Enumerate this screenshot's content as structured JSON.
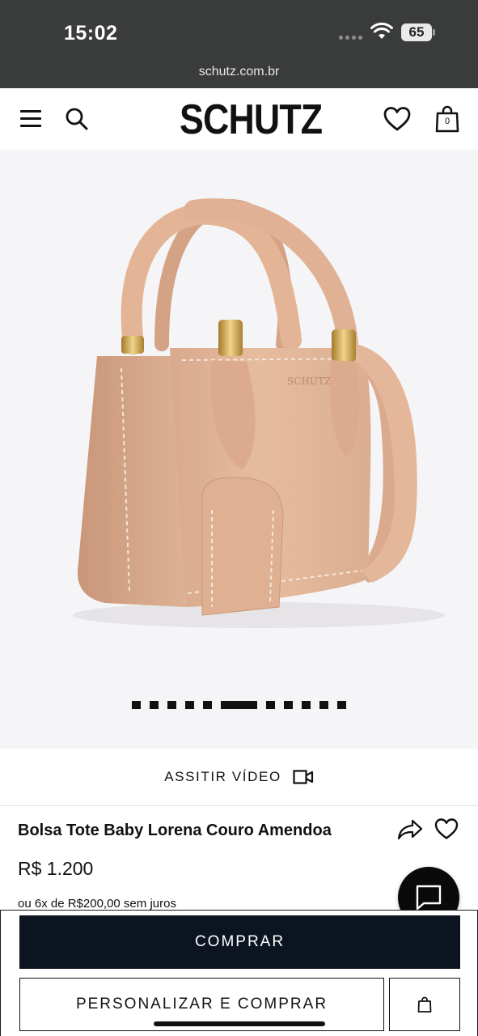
{
  "status_bar": {
    "time": "15:02",
    "battery_level": "65"
  },
  "browser": {
    "url": "schutz.com.br"
  },
  "header": {
    "logo": "SCHUTZ",
    "cart_count": "0",
    "icons": [
      "menu-icon",
      "search-icon",
      "heart-icon",
      "shopping-bag-icon"
    ]
  },
  "gallery": {
    "slide_count": 11,
    "active_slide": 5,
    "bag_color": "#e2b59a"
  },
  "video": {
    "label": "ASSITIR VÍDEO"
  },
  "product": {
    "title": "Bolsa Tote Baby Lorena Couro Amendoa",
    "price": "R$ 1.200",
    "installments": "ou 6x de R$200,00 sem juros"
  },
  "actions": {
    "buy_label": "COMPRAR",
    "customize_label": "PERSONALIZAR E COMPRAR"
  },
  "colors": {
    "buy_button": "#0c1421",
    "status_bar": "#3a3b3b",
    "gallery_bg": "#f5f5f7"
  }
}
